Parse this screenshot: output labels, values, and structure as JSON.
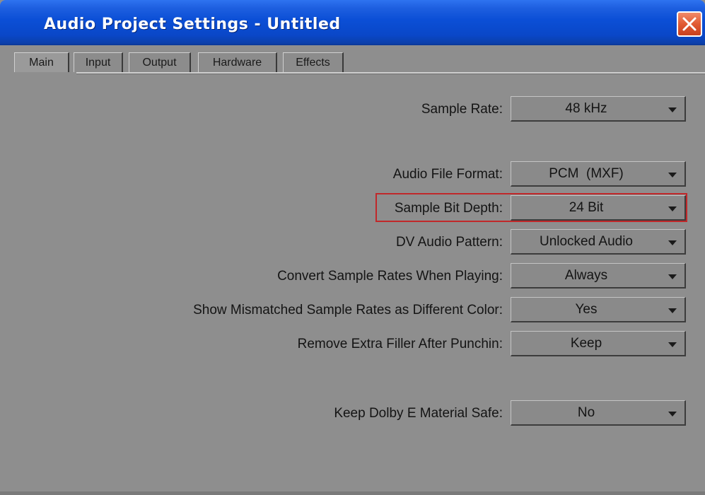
{
  "window": {
    "title": "Audio Project Settings - Untitled",
    "close_icon": "close-icon",
    "accent_color": "#0b4fd6",
    "close_color": "#e15a33"
  },
  "tabs": [
    {
      "label": "Main",
      "active": true
    },
    {
      "label": "Input",
      "active": false
    },
    {
      "label": "Output",
      "active": false
    },
    {
      "label": "Hardware",
      "active": false
    },
    {
      "label": "Effects",
      "active": false
    }
  ],
  "settings": {
    "sample_rate": {
      "label": "Sample Rate:",
      "value": "48 kHz"
    },
    "audio_file_format": {
      "label": "Audio File Format:",
      "value": "PCM  (MXF)"
    },
    "sample_bit_depth": {
      "label": "Sample Bit Depth:",
      "value": "24 Bit",
      "highlight_color": "#c0282a"
    },
    "dv_audio_pattern": {
      "label": "DV Audio Pattern:",
      "value": "Unlocked Audio"
    },
    "convert_sample_rates": {
      "label": "Convert Sample Rates When Playing:",
      "value": "Always"
    },
    "show_mismatched": {
      "label": "Show Mismatched Sample Rates as Different Color:",
      "value": "Yes"
    },
    "remove_extra_filler": {
      "label": "Remove Extra Filler After Punchin:",
      "value": "Keep"
    },
    "keep_dolby_e": {
      "label": "Keep Dolby E Material Safe:",
      "value": "No"
    }
  }
}
